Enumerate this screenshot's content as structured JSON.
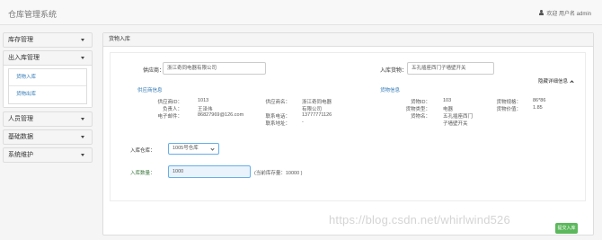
{
  "header": {
    "brand": "仓库管理系统",
    "welcome": "欢迎 用户名 admin",
    "user_icon": "user-icon"
  },
  "sidebar": {
    "groups": [
      {
        "label": "库存管理",
        "expanded": false
      },
      {
        "label": "出入库管理",
        "expanded": true,
        "items": [
          "货物入库",
          "货物出库"
        ]
      },
      {
        "label": "人员管理",
        "expanded": false
      },
      {
        "label": "基础数据",
        "expanded": false
      },
      {
        "label": "系统维护",
        "expanded": false
      }
    ]
  },
  "main": {
    "title": "货物入库",
    "supplier_label": "供应商：",
    "supplier_value": "浙江奇同电器有限公司",
    "goods_label": "入库货物：",
    "goods_value": "五孔插座西门子墙壁开关",
    "hide_details": "隐藏详细信息",
    "supplier_info": {
      "title": "供应商信息",
      "rows": [
        {
          "k1": "供应商ID：",
          "v1": "1013",
          "k2": "供应商名：",
          "v2": "浙江奇同电器"
        },
        {
          "k1": "负责人：",
          "v1": "王泽伟",
          "k2": "",
          "v2": "有限公司"
        },
        {
          "k1": "电子邮件：",
          "v1": "86827969@126.com",
          "k2": "联系电话：",
          "v2": "13777771126"
        },
        {
          "k1": "",
          "v1": "",
          "k2": "联系地址：",
          "v2": "-"
        }
      ]
    },
    "goods_info": {
      "title": "货物信息",
      "rows": [
        {
          "k1": "货物ID：",
          "v1": "103",
          "k2": "货物规格：",
          "v2": "86*86"
        },
        {
          "k1": "货物类型：",
          "v1": "电器",
          "k2": "货物价值：",
          "v2": "1.85"
        },
        {
          "k1": "货物名：",
          "v1": "五孔插座西门",
          "k2": "",
          "v2": ""
        },
        {
          "k1": "",
          "v1": "子墙壁开关",
          "k2": "",
          "v2": ""
        }
      ]
    },
    "warehouse_label": "入库仓库：",
    "warehouse_value": "1005号仓库",
    "quantity_label": "入库数量：",
    "quantity_value": "1000",
    "stock_note": "(当前库存量：10000 )",
    "submit_label": "提交入库"
  },
  "watermark": "https://blog.csdn.net/whirlwind526"
}
